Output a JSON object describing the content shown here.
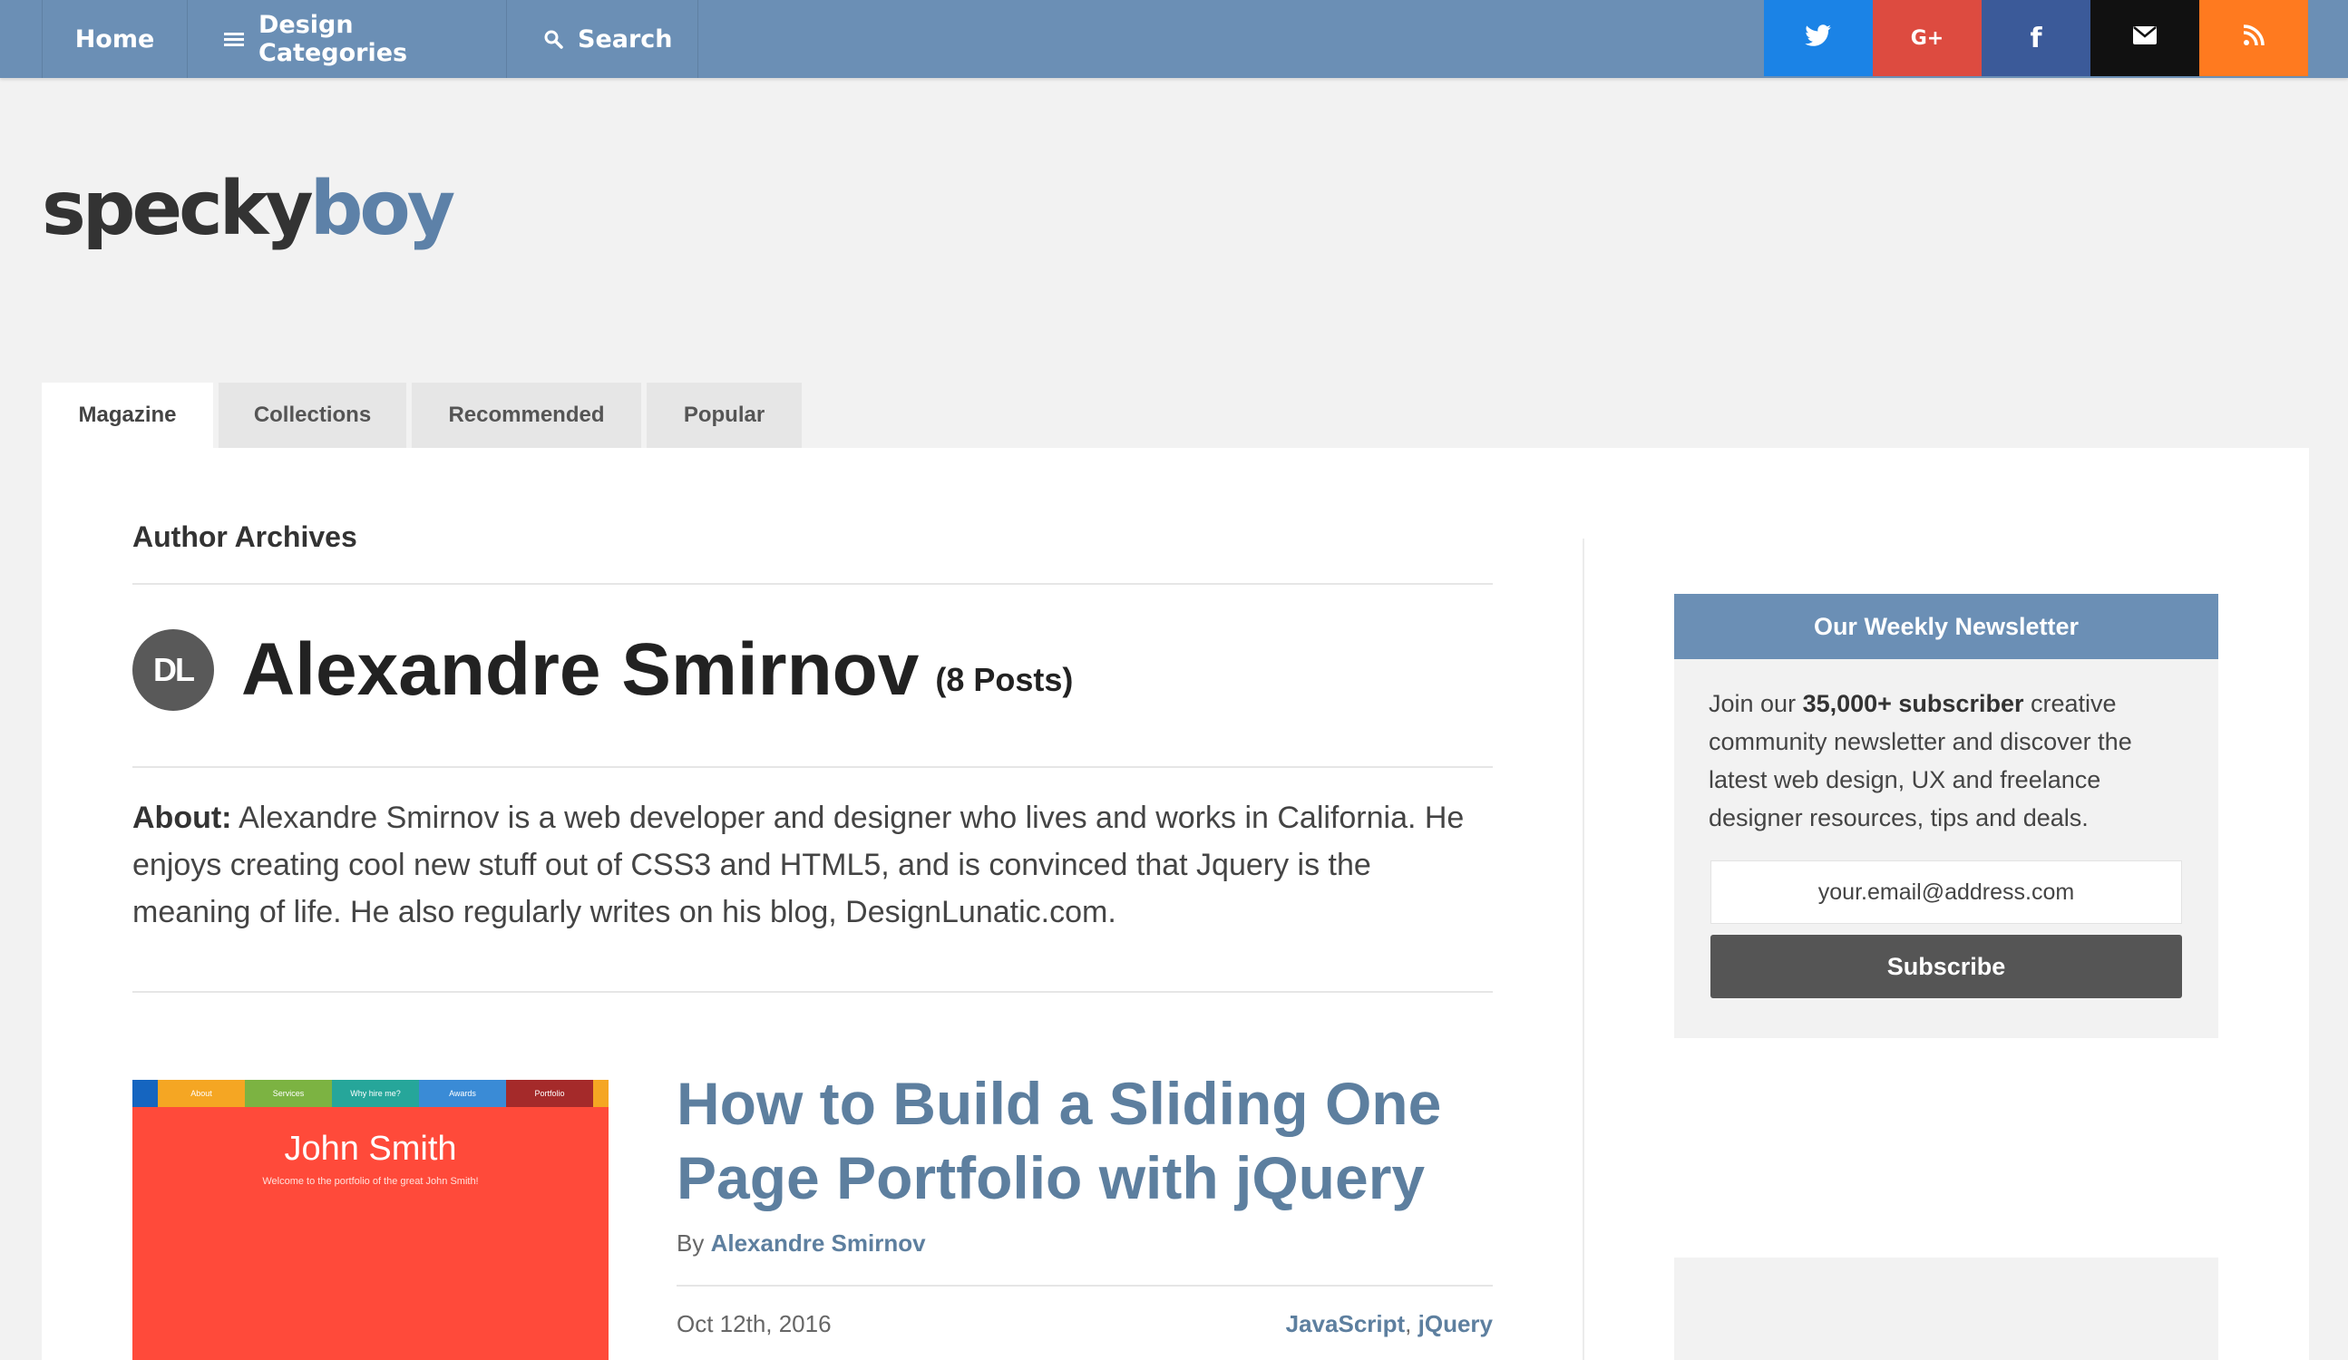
{
  "nav": {
    "home": "Home",
    "categories": "Design Categories",
    "search": "Search"
  },
  "social": [
    {
      "name": "twitter",
      "color": "#1b83e6",
      "glyph": "twitter-icon"
    },
    {
      "name": "google-plus",
      "color": "#dd4b40",
      "glyph": "G+"
    },
    {
      "name": "facebook",
      "color": "#3b5a99",
      "glyph": "f"
    },
    {
      "name": "email",
      "color": "#111111",
      "glyph": "mail-icon"
    },
    {
      "name": "rss",
      "color": "#ff7a1f",
      "glyph": "rss-icon"
    }
  ],
  "logo": {
    "part1": "specky",
    "part2": "boy"
  },
  "tabs": [
    "Magazine",
    "Collections",
    "Recommended",
    "Popular"
  ],
  "archive": {
    "title": "Author Archives",
    "avatar_initials": "DL",
    "author_name": "Alexandre Smirnov",
    "post_count": "(8 Posts)",
    "about_label": "About:",
    "about_text": " Alexandre Smirnov is a web developer and designer who lives and works in California. He enjoys creating cool new stuff out of CSS3 and HTML5, and is convinced that Jquery is the meaning of life. He also regularly writes on his blog, DesignLunatic.com."
  },
  "post": {
    "title": "How to Build a Sliding One Page Portfolio with jQuery",
    "by_label": "By ",
    "author": "Alexandre Smirnov",
    "date": "Oct 12th, 2016",
    "category1": "JavaScript",
    "separator": ", ",
    "category2": "jQuery",
    "thumb": {
      "nav": [
        "About",
        "Services",
        "Why hire me?",
        "Awards",
        "Portfolio"
      ],
      "name": "John Smith",
      "subtitle": "Welcome to the portfolio of the great John Smith!"
    }
  },
  "newsletter": {
    "heading": "Our Weekly Newsletter",
    "text_before": "Join our ",
    "text_bold": "35,000+ subscriber",
    "text_after": " creative community newsletter and discover the latest web design, UX and freelance designer resources, tips and deals.",
    "placeholder": "your.email@address.com",
    "button": "Subscribe"
  },
  "colors": {
    "topbar": "#6b8fb5",
    "link": "#5d7f9f",
    "thumb_bg": "#ff4a3a"
  }
}
